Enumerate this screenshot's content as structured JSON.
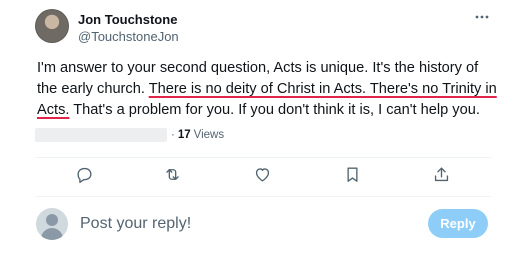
{
  "author": {
    "name": "Jon Touchstone",
    "handle": "@TouchstoneJon"
  },
  "post": {
    "text_before": "I'm answer to your second question, Acts is unique. It's the history of the early church. ",
    "text_highlighted": "There is no deity of Christ in Acts. There's no Trinity in Acts.",
    "text_after": " That's a problem for you. If you don't think it is, I can't help you.",
    "highlight_color": "#e0244a"
  },
  "meta": {
    "separator": "·",
    "views_count": "17",
    "views_label": "Views"
  },
  "actions": {
    "more_icon": "more-horizontal-icon",
    "items": [
      {
        "icon": "reply-icon"
      },
      {
        "icon": "repost-icon"
      },
      {
        "icon": "like-icon"
      },
      {
        "icon": "bookmark-icon"
      },
      {
        "icon": "share-icon"
      }
    ]
  },
  "reply": {
    "placeholder": "Post your reply!",
    "button_label": "Reply",
    "button_color": "#8ecdf8"
  }
}
